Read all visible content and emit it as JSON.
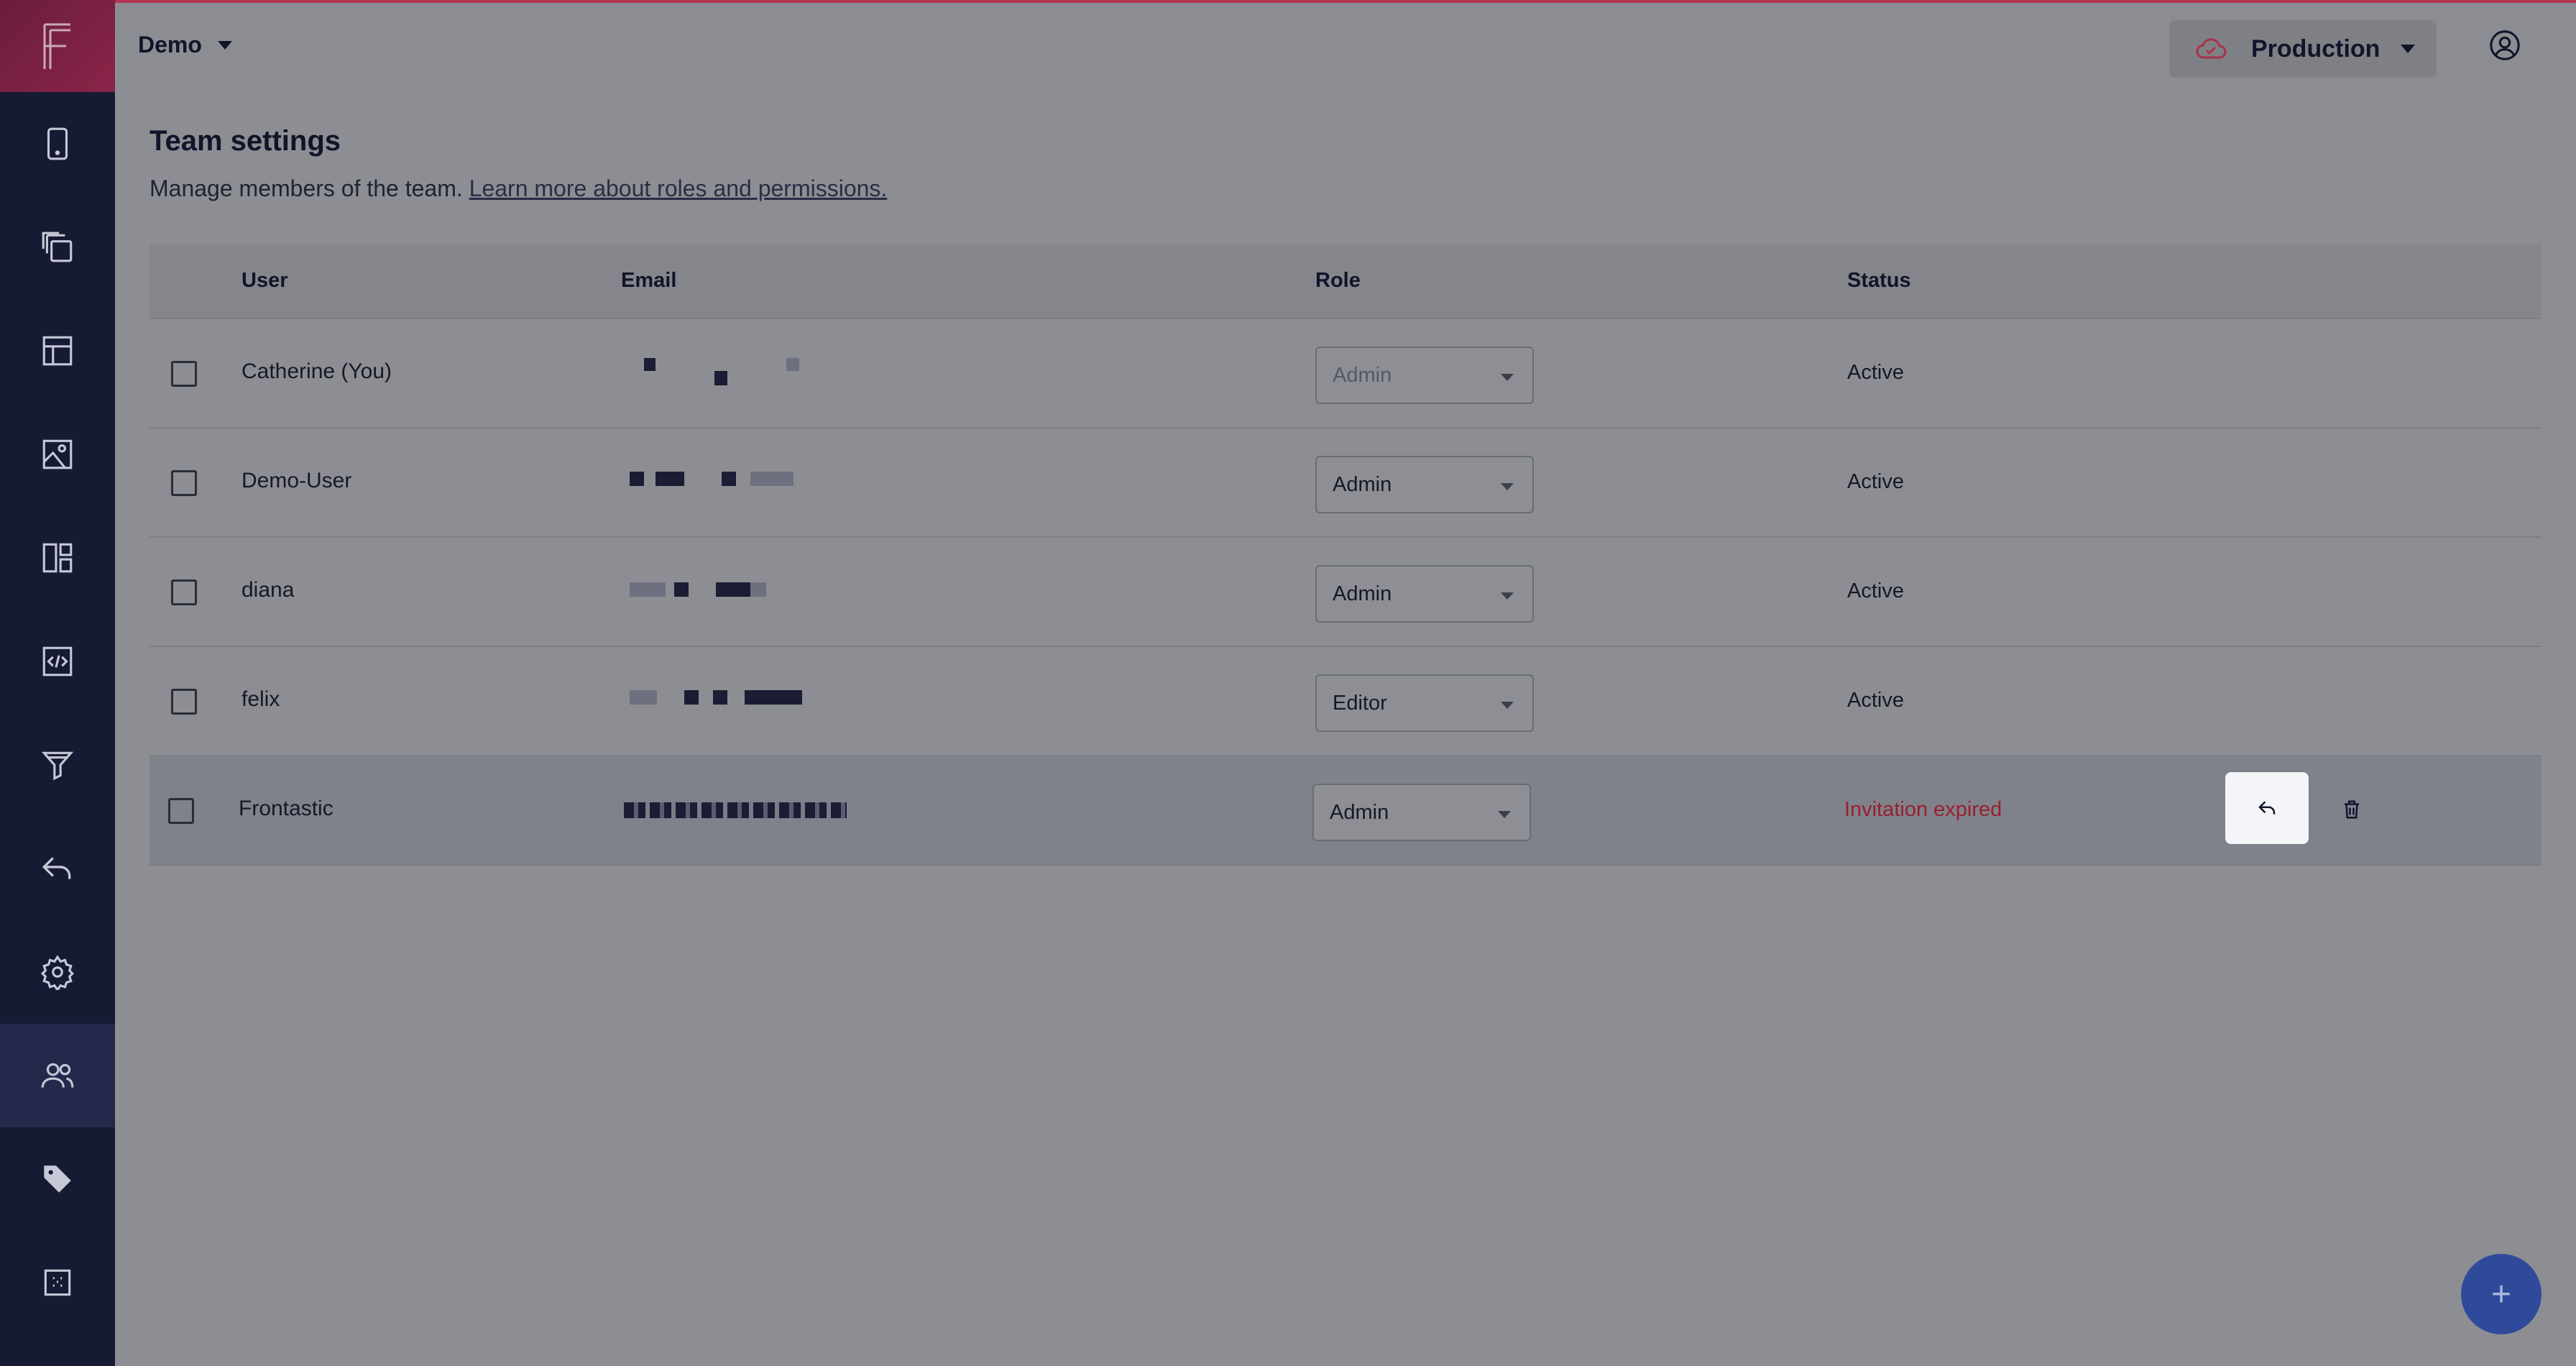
{
  "header": {
    "project": "Demo",
    "environment": "Production"
  },
  "page": {
    "title": "Team settings",
    "subtitle": "Manage members of the team.",
    "link_text": "Learn more about roles and permissions."
  },
  "table": {
    "columns": [
      "User",
      "Email",
      "Role",
      "Status"
    ],
    "rows": [
      {
        "user": "Catherine (You)",
        "role": "Admin",
        "status": "Active",
        "role_disabled": true
      },
      {
        "user": "Demo-User",
        "role": "Admin",
        "status": "Active"
      },
      {
        "user": "diana",
        "role": "Admin",
        "status": "Active"
      },
      {
        "user": "felix",
        "role": "Editor",
        "status": "Active"
      },
      {
        "user": "Frontastic",
        "role": "Admin",
        "status": "Invitation expired"
      }
    ]
  },
  "sidebar": {
    "items": [
      "mobile-icon",
      "copy-icon",
      "layout-icon",
      "image-icon",
      "dashboard-icon",
      "code-icon",
      "filter-icon",
      "reply-icon",
      "gear-icon",
      "team-icon",
      "tag-icon",
      "grid-icon"
    ],
    "active": "team-icon"
  },
  "colors": {
    "sidebar": "#161a33",
    "brand": "#8a2449",
    "fab": "#2f4a9a",
    "expired": "#9a1f2e"
  },
  "fab_label": "+"
}
